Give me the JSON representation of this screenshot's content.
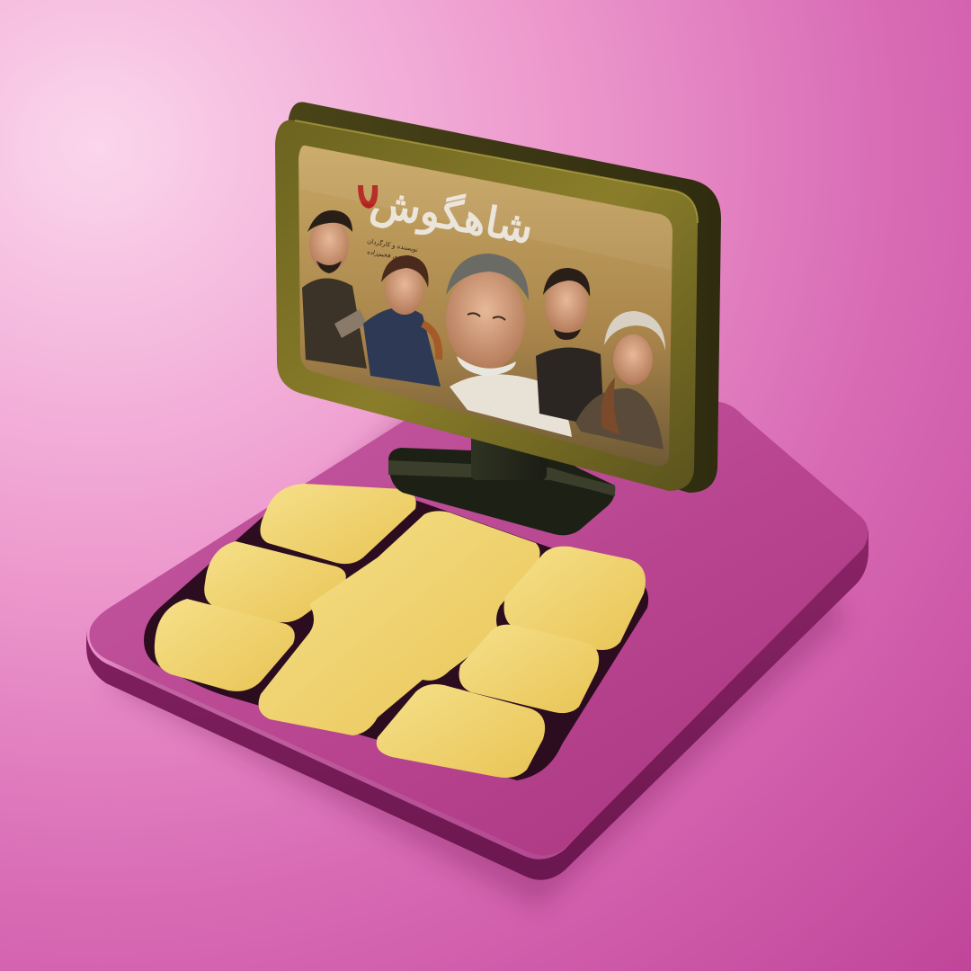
{
  "scene": {
    "description_colors": {
      "background": "#e38ac4",
      "sim_body": "#a8357f",
      "chip_gold": "#f0d470",
      "frame_gold": "#8a7a22"
    }
  },
  "poster": {
    "title": "شاهگوش",
    "credit_line_1": "نویسنده و کارگردان",
    "credit_line_2": "مهدی فخیم‌زاده",
    "emblem": "red-horseshoe-emblem"
  }
}
